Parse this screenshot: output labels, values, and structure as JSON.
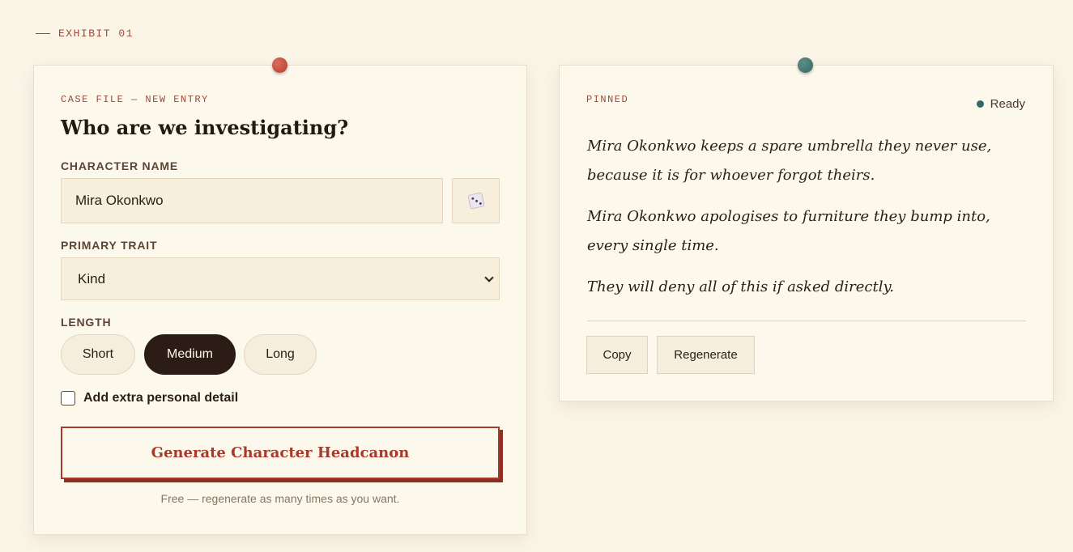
{
  "exhibit": {
    "label": "EXHIBIT 01"
  },
  "form": {
    "kicker": "CASE FILE — NEW ENTRY",
    "heading": "Who are we investigating?",
    "name_label": "CHARACTER NAME",
    "name_value": "Mira Okonkwo",
    "randomize_icon": "dice-icon",
    "trait_label": "PRIMARY TRAIT",
    "trait_value": "Kind",
    "length_label": "LENGTH",
    "length_options": [
      "Short",
      "Medium",
      "Long"
    ],
    "length_selected": "Medium",
    "extra_detail_label": "Add extra personal detail",
    "extra_detail_checked": false,
    "generate_label": "Generate Character Headcanon",
    "footnote": "Free — regenerate as many times as you want."
  },
  "result": {
    "kicker": "PINNED",
    "status": "Ready",
    "headcanons": [
      "Mira Okonkwo keeps a spare umbrella they never use, because it is for whoever forgot theirs.",
      "Mira Okonkwo apologises to furniture they bump into, every single time.",
      "They will deny all of this if asked directly."
    ],
    "copy_label": "Copy",
    "regenerate_label": "Regenerate"
  },
  "colors": {
    "background": "#fbf5e8",
    "accent_red": "#a63a2c",
    "accent_teal": "#356865",
    "dark": "#2b1d15"
  }
}
